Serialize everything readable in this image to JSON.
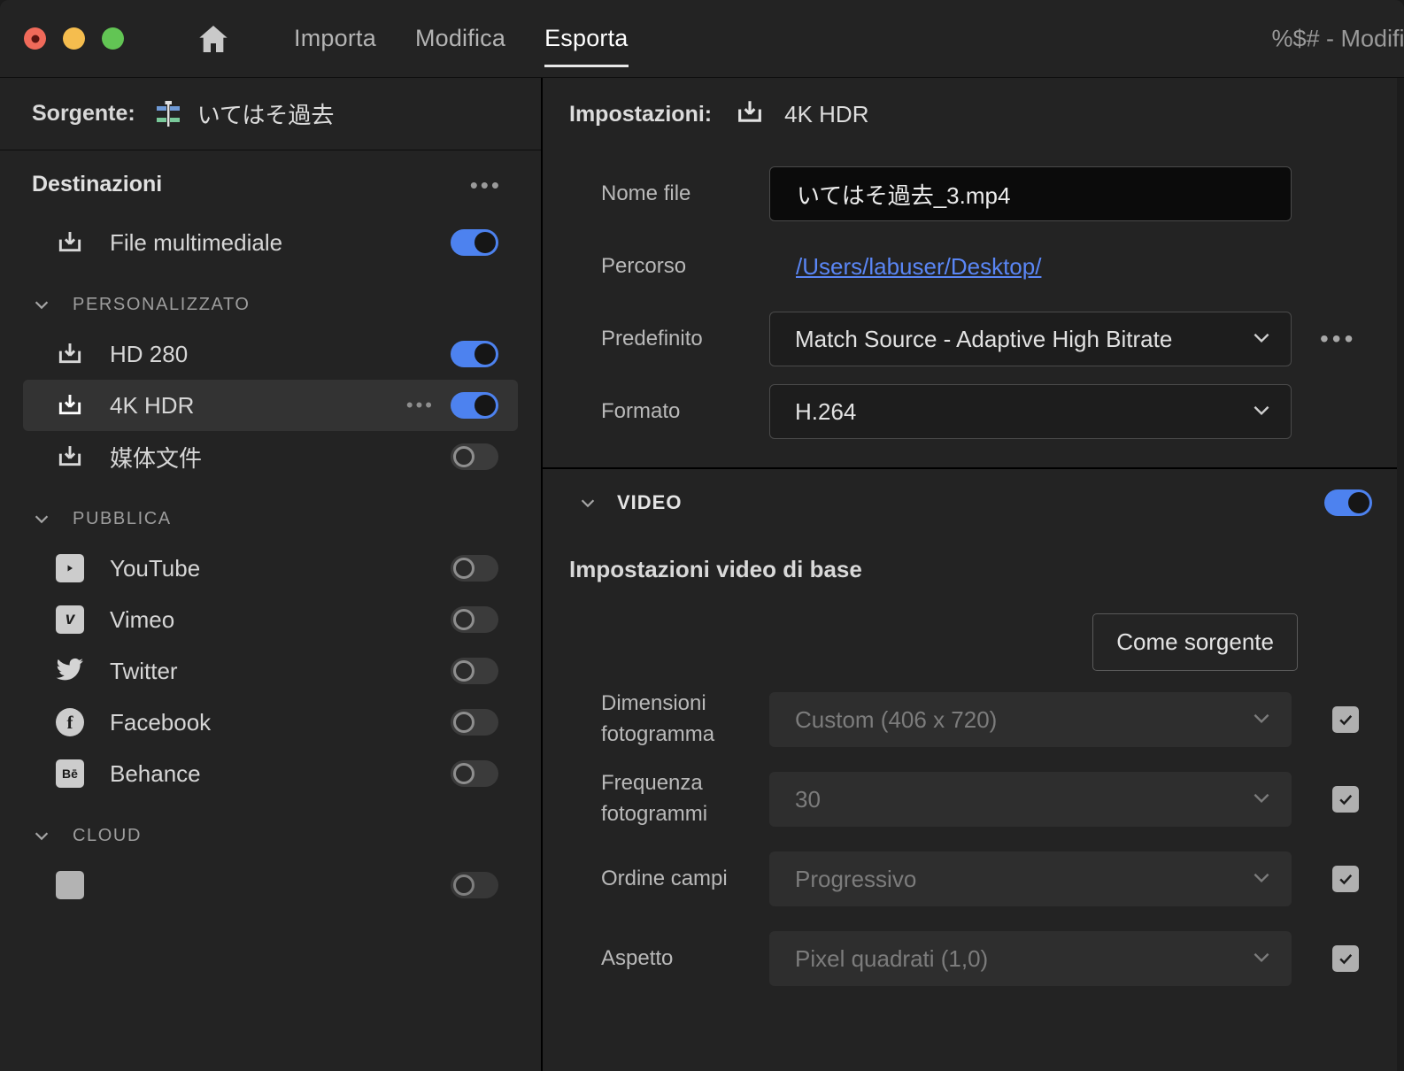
{
  "window": {
    "title": "%$# - Modific",
    "traffic_lights": [
      "close",
      "minimize",
      "zoom"
    ]
  },
  "nav": {
    "home_icon": "home-icon",
    "tabs": [
      {
        "label": "Importa",
        "active": false
      },
      {
        "label": "Modifica",
        "active": false
      },
      {
        "label": "Esporta",
        "active": true
      }
    ]
  },
  "source": {
    "label": "Sorgente:",
    "name": "いてはそ過去",
    "icon": "sequence-icon"
  },
  "destinations": {
    "title": "Destinazioni",
    "more_label": "•••",
    "media_file": {
      "label": "File multimediale",
      "toggle": "on",
      "icon": "download-icon"
    },
    "groups": [
      {
        "name": "PERSONALIZZATO",
        "expanded": true,
        "items": [
          {
            "label": "HD 280",
            "toggle": "on",
            "icon": "download-icon",
            "selected": false,
            "has_dots": false
          },
          {
            "label": "4K HDR",
            "toggle": "on",
            "icon": "download-icon",
            "selected": true,
            "has_dots": true
          },
          {
            "label": "媒体文件",
            "toggle": "off",
            "icon": "download-icon",
            "selected": false,
            "has_dots": false
          }
        ]
      },
      {
        "name": "PUBBLICA",
        "expanded": true,
        "items": [
          {
            "label": "YouTube",
            "toggle": "off",
            "icon": "youtube-icon",
            "selected": false,
            "has_dots": false
          },
          {
            "label": "Vimeo",
            "toggle": "off",
            "icon": "vimeo-icon",
            "selected": false,
            "has_dots": false
          },
          {
            "label": "Twitter",
            "toggle": "off",
            "icon": "twitter-icon",
            "selected": false,
            "has_dots": false
          },
          {
            "label": "Facebook",
            "toggle": "off",
            "icon": "facebook-icon",
            "selected": false,
            "has_dots": false
          },
          {
            "label": "Behance",
            "toggle": "off",
            "icon": "behance-icon",
            "selected": false,
            "has_dots": false
          }
        ]
      },
      {
        "name": "CLOUD",
        "expanded": true,
        "items": []
      }
    ]
  },
  "settings": {
    "label": "Impostazioni:",
    "name": "4K HDR",
    "icon": "download-icon",
    "fields": {
      "filename": {
        "label": "Nome file",
        "value": "いてはそ過去_3.mp4"
      },
      "path": {
        "label": "Percorso",
        "value": "/Users/labuser/Desktop/"
      },
      "preset": {
        "label": "Predefinito",
        "value": "Match Source - Adaptive High Bitrate",
        "more_label": "•••"
      },
      "format": {
        "label": "Formato",
        "value": "H.264"
      }
    }
  },
  "video": {
    "title": "VIDEO",
    "toggle": "on",
    "subhead": "Impostazioni video di base",
    "match_source_button": "Come sorgente",
    "rows": [
      {
        "label": "Dimensioni fotogramma",
        "value": "Custom (406 x 720)",
        "checked": true,
        "disabled": true
      },
      {
        "label": "Frequenza fotogrammi",
        "value": "30",
        "checked": true,
        "disabled": true
      },
      {
        "label": "Ordine campi",
        "value": "Progressivo",
        "checked": true,
        "disabled": true
      },
      {
        "label": "Aspetto",
        "value": "Pixel quadrati (1,0)",
        "checked": true,
        "disabled": true
      }
    ]
  },
  "colors": {
    "accent_blue": "#4d82ef",
    "link_blue": "#5a86f5",
    "panel_bg": "#232323",
    "selected_row": "#333333",
    "input_bg": "#0b0b0b"
  }
}
